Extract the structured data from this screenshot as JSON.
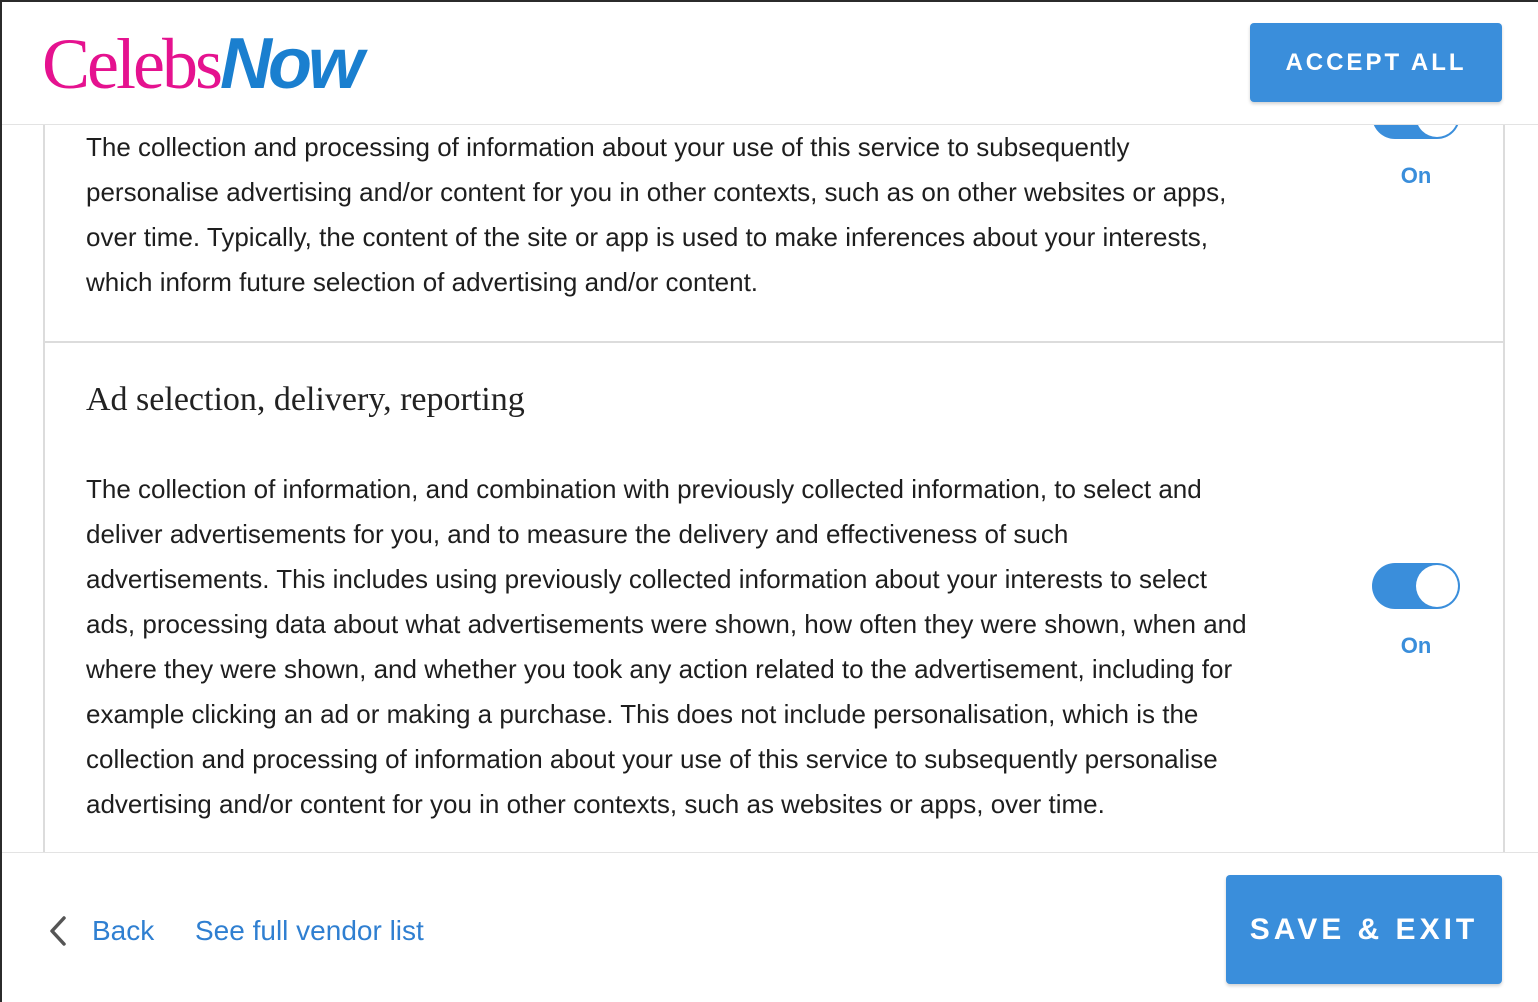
{
  "brand": {
    "logo_part1": "Celebs",
    "logo_part2": "Now",
    "color_pink": "#e5128f",
    "color_blue": "#1a7fcf"
  },
  "header": {
    "accept_all_label": "ACCEPT ALL"
  },
  "purposes": [
    {
      "title": "",
      "description": "The collection and processing of information about your use of this service to subsequently personalise advertising and/or content for you in other contexts, such as on other websites or apps, over time. Typically, the content of the site or app is used to make inferences about your interests, which inform future selection of advertising and/or content.",
      "toggle_on": true,
      "toggle_label": "On"
    },
    {
      "title": "Ad selection, delivery, reporting",
      "description": "The collection of information, and combination with previously collected information, to select and deliver advertisements for you, and to measure the delivery and effectiveness of such advertisements. This includes using previously collected information about your interests to select ads, processing data about what advertisements were shown, how often they were shown, when and where they were shown, and whether you took any action related to the advertisement, including for example clicking an ad or making a purchase. This does not include personalisation, which is the collection and processing of information about your use of this service to subsequently personalise advertising and/or content for you in other contexts, such as websites or apps, over time.",
      "toggle_on": true,
      "toggle_label": "On"
    }
  ],
  "footer": {
    "back_label": "Back",
    "vendor_list_label": "See full vendor list",
    "save_exit_label": "SAVE & EXIT"
  },
  "accent_color": "#3a8edb"
}
